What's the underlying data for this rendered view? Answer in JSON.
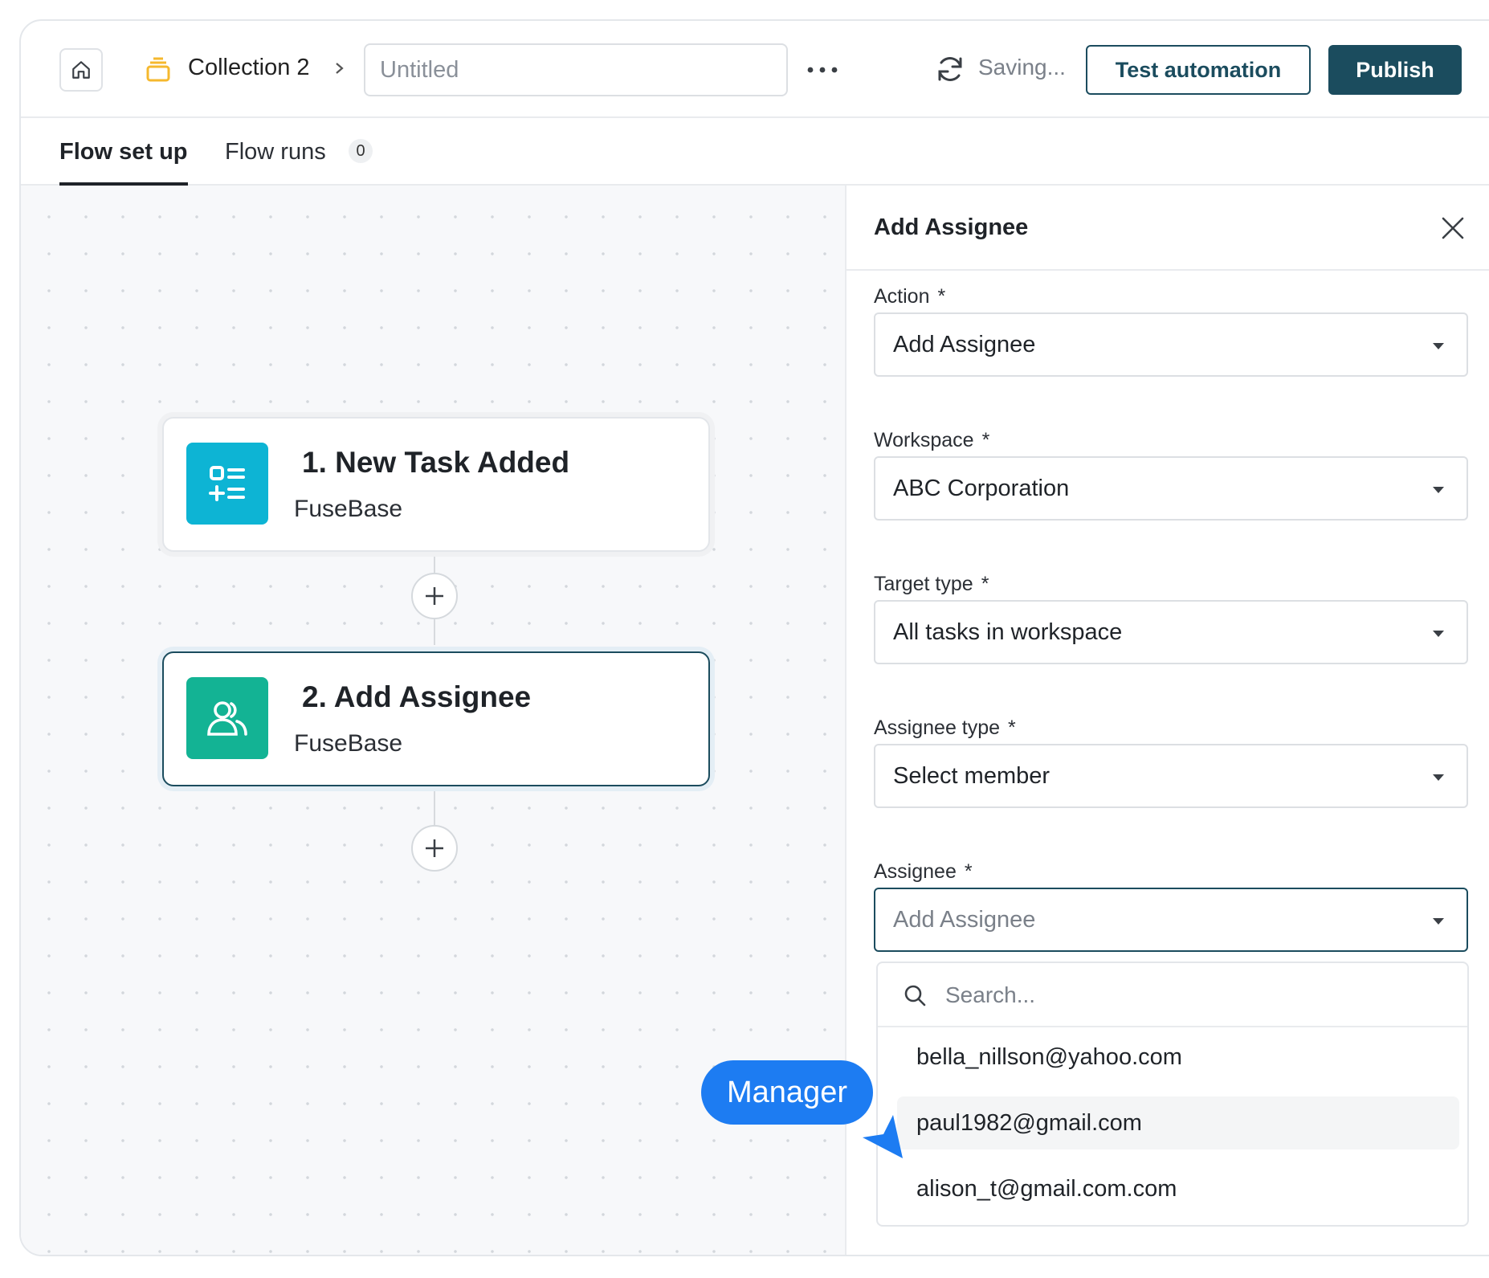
{
  "header": {
    "collection_name": "Collection 2",
    "title_placeholder": "Untitled",
    "saving_text": "Saving...",
    "test_button": "Test automation",
    "publish_button": "Publish"
  },
  "tabs": [
    {
      "label": "Flow set up",
      "active": true
    },
    {
      "label": "Flow runs",
      "badge": "0"
    }
  ],
  "flow": {
    "nodes": [
      {
        "title": "1. New Task Added",
        "subtitle": "FuseBase",
        "icon": "task-list-icon",
        "color": "#0db4d4"
      },
      {
        "title": "2. Add Assignee",
        "subtitle": "FuseBase",
        "icon": "users-icon",
        "color": "#13b394"
      }
    ]
  },
  "panel": {
    "title": "Add Assignee",
    "fields": [
      {
        "label": "Action",
        "required": "*",
        "value": "Add Assignee"
      },
      {
        "label": "Workspace",
        "required": "*",
        "value": "ABC Corporation"
      },
      {
        "label": "Target type",
        "required": "*",
        "value": "All tasks in workspace"
      },
      {
        "label": "Assignee type",
        "required": "*",
        "value": "Select member"
      },
      {
        "label": "Assignee",
        "required": "*",
        "placeholder": "Add Assignee"
      }
    ],
    "dropdown": {
      "search_placeholder": "Search...",
      "options": [
        "bella_nillson@yahoo.com",
        "paul1982@gmail.com",
        "alison_t@gmail.com.com"
      ]
    }
  },
  "tooltip": {
    "label": "Manager",
    "color": "#1d7cf2"
  },
  "colors": {
    "brand": "#1b4c5e",
    "collection_icon": "#f5b82e"
  }
}
